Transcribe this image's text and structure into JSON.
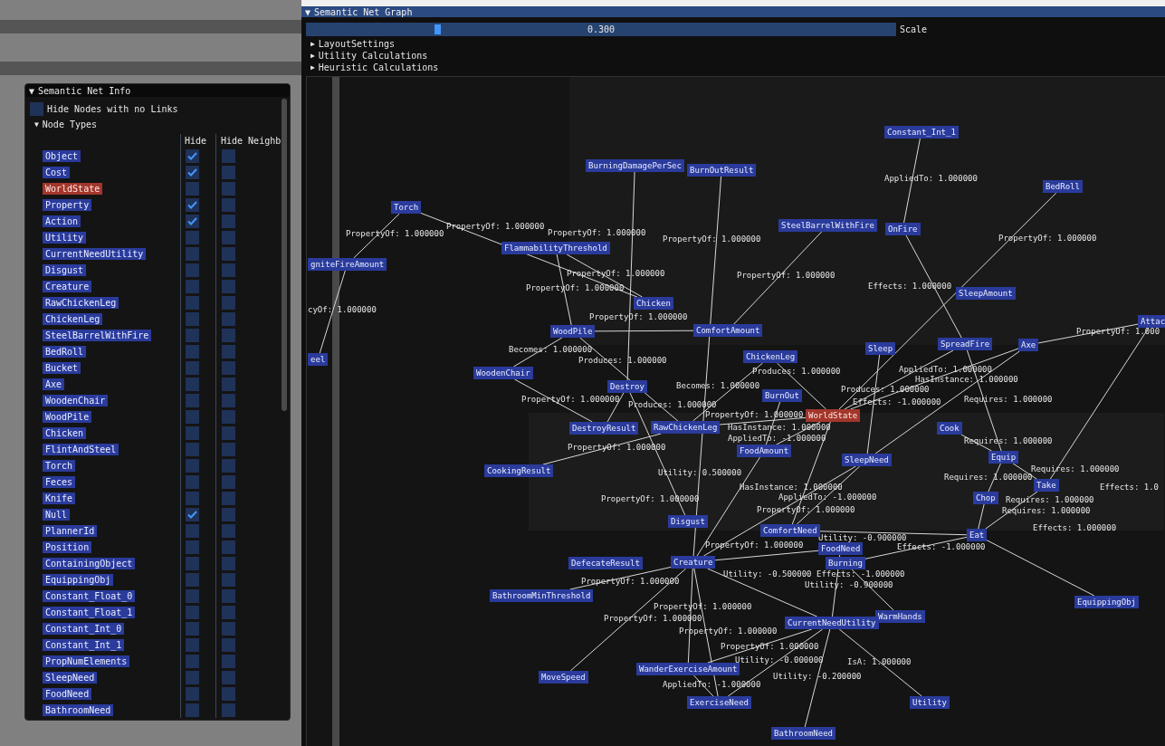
{
  "info_window": {
    "toggle": "▼",
    "title": "Semantic Net Info",
    "hide_no_links": {
      "label": "Hide Nodes with no Links",
      "checked": false
    },
    "node_types_toggle": "▼",
    "node_types_label": "Node Types",
    "columns": [
      "Hide",
      "Hide Neighb"
    ],
    "node_types": [
      {
        "label": "Object",
        "kind": "type",
        "hide": true,
        "hide_neighbors": false
      },
      {
        "label": "Cost",
        "kind": "type",
        "hide": true,
        "hide_neighbors": false
      },
      {
        "label": "WorldState",
        "kind": "worldstate",
        "hide": false,
        "hide_neighbors": false
      },
      {
        "label": "Property",
        "kind": "type",
        "hide": true,
        "hide_neighbors": false
      },
      {
        "label": "Action",
        "kind": "type",
        "hide": true,
        "hide_neighbors": false
      },
      {
        "label": "Utility",
        "kind": "type",
        "hide": false,
        "hide_neighbors": false
      },
      {
        "label": "CurrentNeedUtility",
        "kind": "type",
        "hide": false,
        "hide_neighbors": false
      },
      {
        "label": "Disgust",
        "kind": "type",
        "hide": false,
        "hide_neighbors": false
      },
      {
        "label": "Creature",
        "kind": "type",
        "hide": false,
        "hide_neighbors": false
      },
      {
        "label": "RawChickenLeg",
        "kind": "type",
        "hide": false,
        "hide_neighbors": false
      },
      {
        "label": "ChickenLeg",
        "kind": "type",
        "hide": false,
        "hide_neighbors": false
      },
      {
        "label": "SteelBarrelWithFire",
        "kind": "type",
        "hide": false,
        "hide_neighbors": false
      },
      {
        "label": "BedRoll",
        "kind": "type",
        "hide": false,
        "hide_neighbors": false
      },
      {
        "label": "Bucket",
        "kind": "type",
        "hide": false,
        "hide_neighbors": false
      },
      {
        "label": "Axe",
        "kind": "type",
        "hide": false,
        "hide_neighbors": false
      },
      {
        "label": "WoodenChair",
        "kind": "type",
        "hide": false,
        "hide_neighbors": false
      },
      {
        "label": "WoodPile",
        "kind": "type",
        "hide": false,
        "hide_neighbors": false
      },
      {
        "label": "Chicken",
        "kind": "type",
        "hide": false,
        "hide_neighbors": false
      },
      {
        "label": "FlintAndSteel",
        "kind": "type",
        "hide": false,
        "hide_neighbors": false
      },
      {
        "label": "Torch",
        "kind": "type",
        "hide": false,
        "hide_neighbors": false
      },
      {
        "label": "Feces",
        "kind": "type",
        "hide": false,
        "hide_neighbors": false
      },
      {
        "label": "Knife",
        "kind": "type",
        "hide": false,
        "hide_neighbors": false
      },
      {
        "label": "Null",
        "kind": "type",
        "hide": true,
        "hide_neighbors": false
      },
      {
        "label": "PlannerId",
        "kind": "type",
        "hide": false,
        "hide_neighbors": false
      },
      {
        "label": "Position",
        "kind": "type",
        "hide": false,
        "hide_neighbors": false
      },
      {
        "label": "ContainingObject",
        "kind": "type",
        "hide": false,
        "hide_neighbors": false
      },
      {
        "label": "EquippingObj",
        "kind": "type",
        "hide": false,
        "hide_neighbors": false
      },
      {
        "label": "Constant_Float_0",
        "kind": "type",
        "hide": false,
        "hide_neighbors": false
      },
      {
        "label": "Constant_Float_1",
        "kind": "type",
        "hide": false,
        "hide_neighbors": false
      },
      {
        "label": "Constant_Int_0",
        "kind": "type",
        "hide": false,
        "hide_neighbors": false
      },
      {
        "label": "Constant_Int_1",
        "kind": "type",
        "hide": false,
        "hide_neighbors": false
      },
      {
        "label": "PropNumElements",
        "kind": "type",
        "hide": false,
        "hide_neighbors": false
      },
      {
        "label": "SleepNeed",
        "kind": "type",
        "hide": false,
        "hide_neighbors": false
      },
      {
        "label": "FoodNeed",
        "kind": "type",
        "hide": false,
        "hide_neighbors": false
      },
      {
        "label": "BathroomNeed",
        "kind": "type",
        "hide": false,
        "hide_neighbors": false
      }
    ]
  },
  "graph_window": {
    "toggle": "▼",
    "title": "Semantic Net Graph",
    "scale": {
      "value": "0.300",
      "level": 0.22,
      "label": "Scale"
    },
    "sections": [
      {
        "arrow": "▶",
        "label": "LayoutSettings",
        "expanded": false
      },
      {
        "arrow": "▶",
        "label": "Utility Calculations",
        "expanded": false
      },
      {
        "arrow": "▶",
        "label": "Heuristic Calculations",
        "expanded": false
      }
    ],
    "nodes": [
      {
        "label": "Constant_Int_1",
        "kind": "node"
      },
      {
        "label": "BurningDamagePerSec",
        "kind": "node"
      },
      {
        "label": "BurnOutResult",
        "kind": "node"
      },
      {
        "label": "BedRoll",
        "kind": "node"
      },
      {
        "label": "Torch",
        "kind": "node"
      },
      {
        "label": "SteelBarrelWithFire",
        "kind": "node"
      },
      {
        "label": "OnFire",
        "kind": "node"
      },
      {
        "label": "FlammabilityThreshold",
        "kind": "node"
      },
      {
        "label": "gniteFireAmount",
        "kind": "node"
      },
      {
        "label": "SleepAmount",
        "kind": "node"
      },
      {
        "label": "Chicken",
        "kind": "node"
      },
      {
        "label": "Attac",
        "kind": "node"
      },
      {
        "label": "WoodPile",
        "kind": "node"
      },
      {
        "label": "ComfortAmount",
        "kind": "node"
      },
      {
        "label": "Sleep",
        "kind": "node"
      },
      {
        "label": "SpreadFire",
        "kind": "node"
      },
      {
        "label": "Axe",
        "kind": "node"
      },
      {
        "label": "eel",
        "kind": "node"
      },
      {
        "label": "ChickenLeg",
        "kind": "node"
      },
      {
        "label": "WoodenChair",
        "kind": "node"
      },
      {
        "label": "Destroy",
        "kind": "node"
      },
      {
        "label": "BurnOut",
        "kind": "node"
      },
      {
        "label": "WorldState",
        "kind": "worldstate"
      },
      {
        "label": "DestroyResult",
        "kind": "node"
      },
      {
        "label": "RawChickenLeg",
        "kind": "node"
      },
      {
        "label": "Cook",
        "kind": "node"
      },
      {
        "label": "FoodAmount",
        "kind": "node"
      },
      {
        "label": "SleepNeed",
        "kind": "node"
      },
      {
        "label": "Equip",
        "kind": "node"
      },
      {
        "label": "CookingResult",
        "kind": "node"
      },
      {
        "label": "Take",
        "kind": "node"
      },
      {
        "label": "Chop",
        "kind": "node"
      },
      {
        "label": "Disgust",
        "kind": "node"
      },
      {
        "label": "ComfortNeed",
        "kind": "node"
      },
      {
        "label": "Eat",
        "kind": "node"
      },
      {
        "label": "FoodNeed",
        "kind": "node"
      },
      {
        "label": "DefecateResult",
        "kind": "node"
      },
      {
        "label": "Creature",
        "kind": "node"
      },
      {
        "label": "Burning",
        "kind": "node"
      },
      {
        "label": "BathroomMinThreshold",
        "kind": "node"
      },
      {
        "label": "EquippingObj",
        "kind": "node"
      },
      {
        "label": "WarmHands",
        "kind": "node"
      },
      {
        "label": "CurrentNeedUtility",
        "kind": "node"
      },
      {
        "label": "MoveSpeed",
        "kind": "node"
      },
      {
        "label": "WanderExerciseAmount",
        "kind": "node"
      },
      {
        "label": "ExerciseNeed",
        "kind": "node"
      },
      {
        "label": "Utility",
        "kind": "node"
      },
      {
        "label": "BathroomNeed",
        "kind": "node"
      }
    ],
    "links": [
      {
        "label": "AppliedTo: 1.000000"
      },
      {
        "label": "PropertyOf: 1.000000"
      },
      {
        "label": "PropertyOf: 1.000000"
      },
      {
        "label": "PropertyOf: 1.000000"
      },
      {
        "label": "PropertyOf: 1.000000"
      },
      {
        "label": "PropertyOf: 1.000000"
      },
      {
        "label": "PropertyOf: 1.000000"
      },
      {
        "label": "PropertyOf: 1.000000"
      },
      {
        "label": "PropertyOf: 1.000000"
      },
      {
        "label": "Effects: 1.000000"
      },
      {
        "label": "cyOf: 1.000000"
      },
      {
        "label": "PropertyOf: 1.000000"
      },
      {
        "label": "PropertyOf: 1.000"
      },
      {
        "label": "Becomes: 1.000000"
      },
      {
        "label": "Produces: 1.000000"
      },
      {
        "label": "Produces: 1.000000"
      },
      {
        "label": "AppliedTo: 1.000000"
      },
      {
        "label": "Becomes: 1.000000"
      },
      {
        "label": "Produces: 1.000000"
      },
      {
        "label": "HasInstance: 1.000000"
      },
      {
        "label": "PropertyOf: 1.000000"
      },
      {
        "label": "Produces: 1.000000"
      },
      {
        "label": "Effects: -1.000000"
      },
      {
        "label": "Requires: 1.000000"
      },
      {
        "label": "PropertyOf: 1.000000"
      },
      {
        "label": "HasInstance: 1.000000"
      },
      {
        "label": "PropertyOf: 1.000000"
      },
      {
        "label": "AppliedTo: -1.000000"
      },
      {
        "label": "Requires: 1.000000"
      },
      {
        "label": "Utility: 0.500000"
      },
      {
        "label": "Requires: 1.000000"
      },
      {
        "label": "Requires: 1.000000"
      },
      {
        "label": "HasInstance: 1.000000"
      },
      {
        "label": "Effects: 1.0"
      },
      {
        "label": "PropertyOf: 1.000000"
      },
      {
        "label": "AppliedTo: -1.000000"
      },
      {
        "label": "Requires: 1.000000"
      },
      {
        "label": "PropertyOf: 1.000000"
      },
      {
        "label": "Requires: 1.000000"
      },
      {
        "label": "Effects: 1.000000"
      },
      {
        "label": "PropertyOf: 1.000000"
      },
      {
        "label": "Utility: -0.900000"
      },
      {
        "label": "Effects: -1.000000"
      },
      {
        "label": "Utility: -0.500000"
      },
      {
        "label": "Effects: -1.000000"
      },
      {
        "label": "PropertyOf: 1.000000"
      },
      {
        "label": "Utility: -0.900000"
      },
      {
        "label": "PropertyOf: 1.000000"
      },
      {
        "label": "PropertyOf: 1.000000"
      },
      {
        "label": "PropertyOf: 1.000000"
      },
      {
        "label": "PropertyOf: 1.000000"
      },
      {
        "label": "Utility: -0.000000"
      },
      {
        "label": "IsA: 1.000000"
      },
      {
        "label": "AppliedTo: -1.000000"
      },
      {
        "label": "Utility: -0.200000"
      }
    ]
  }
}
